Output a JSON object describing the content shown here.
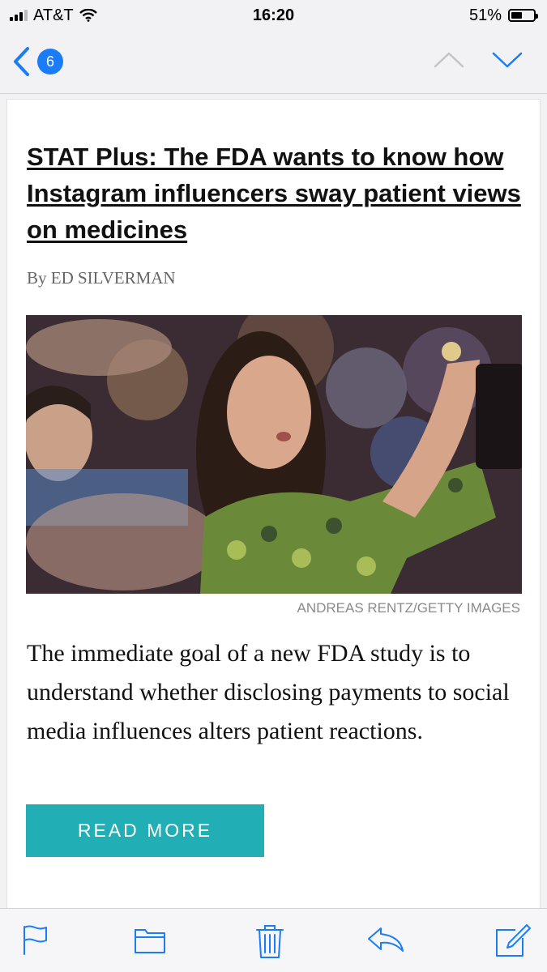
{
  "status_bar": {
    "carrier": "AT&T",
    "time": "16:20",
    "battery_percent": "51%",
    "battery_level": 0.51
  },
  "nav": {
    "back_icon": "chevron-left-icon",
    "unread_count": "6",
    "prev_icon": "chevron-up-icon",
    "next_icon": "chevron-down-icon",
    "accent_color": "#1b7cf7"
  },
  "article": {
    "headline": "STAT Plus: The FDA wants to know how Instagram influencers sway patient views on medicines",
    "byline": "By ED SILVERMAN",
    "image_credit": "ANDREAS RENTZ/GETTY IMAGES",
    "summary": "The immediate goal of a new FDA study is to understand whether disclosing payments to social media influences alters patient reactions.",
    "read_more_label": "READ MORE",
    "button_color": "#21aeb4"
  },
  "toolbar": {
    "icons": [
      "flag-icon",
      "folder-icon",
      "trash-icon",
      "reply-icon",
      "compose-icon"
    ],
    "icon_color": "#1b7cf7"
  }
}
